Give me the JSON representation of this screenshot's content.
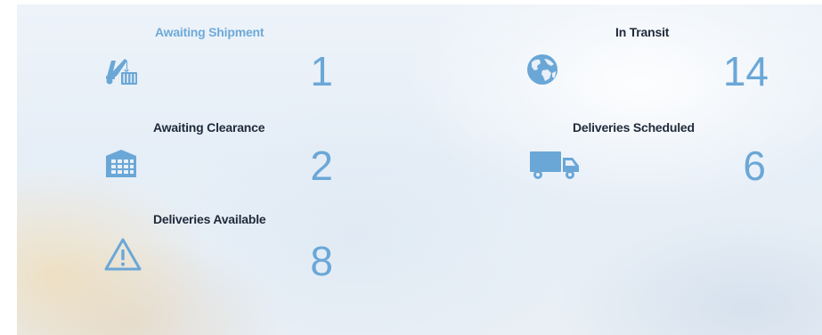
{
  "colors": {
    "accent": "#6aa7d7",
    "heading": "#1f2a3a",
    "active_heading": "#6eaad9"
  },
  "stats": [
    {
      "label": "Awaiting Shipment",
      "count": "1",
      "icon": "crane-cargo-icon",
      "active": true
    },
    {
      "label": "In Transit",
      "count": "14",
      "icon": "globe-icon",
      "active": false
    },
    {
      "label": "Awaiting Clearance",
      "count": "2",
      "icon": "warehouse-icon",
      "active": false
    },
    {
      "label": "Deliveries Scheduled",
      "count": "6",
      "icon": "truck-icon",
      "active": false
    },
    {
      "label": "Deliveries Available",
      "count": "8",
      "icon": "warning-icon",
      "active": false
    }
  ]
}
